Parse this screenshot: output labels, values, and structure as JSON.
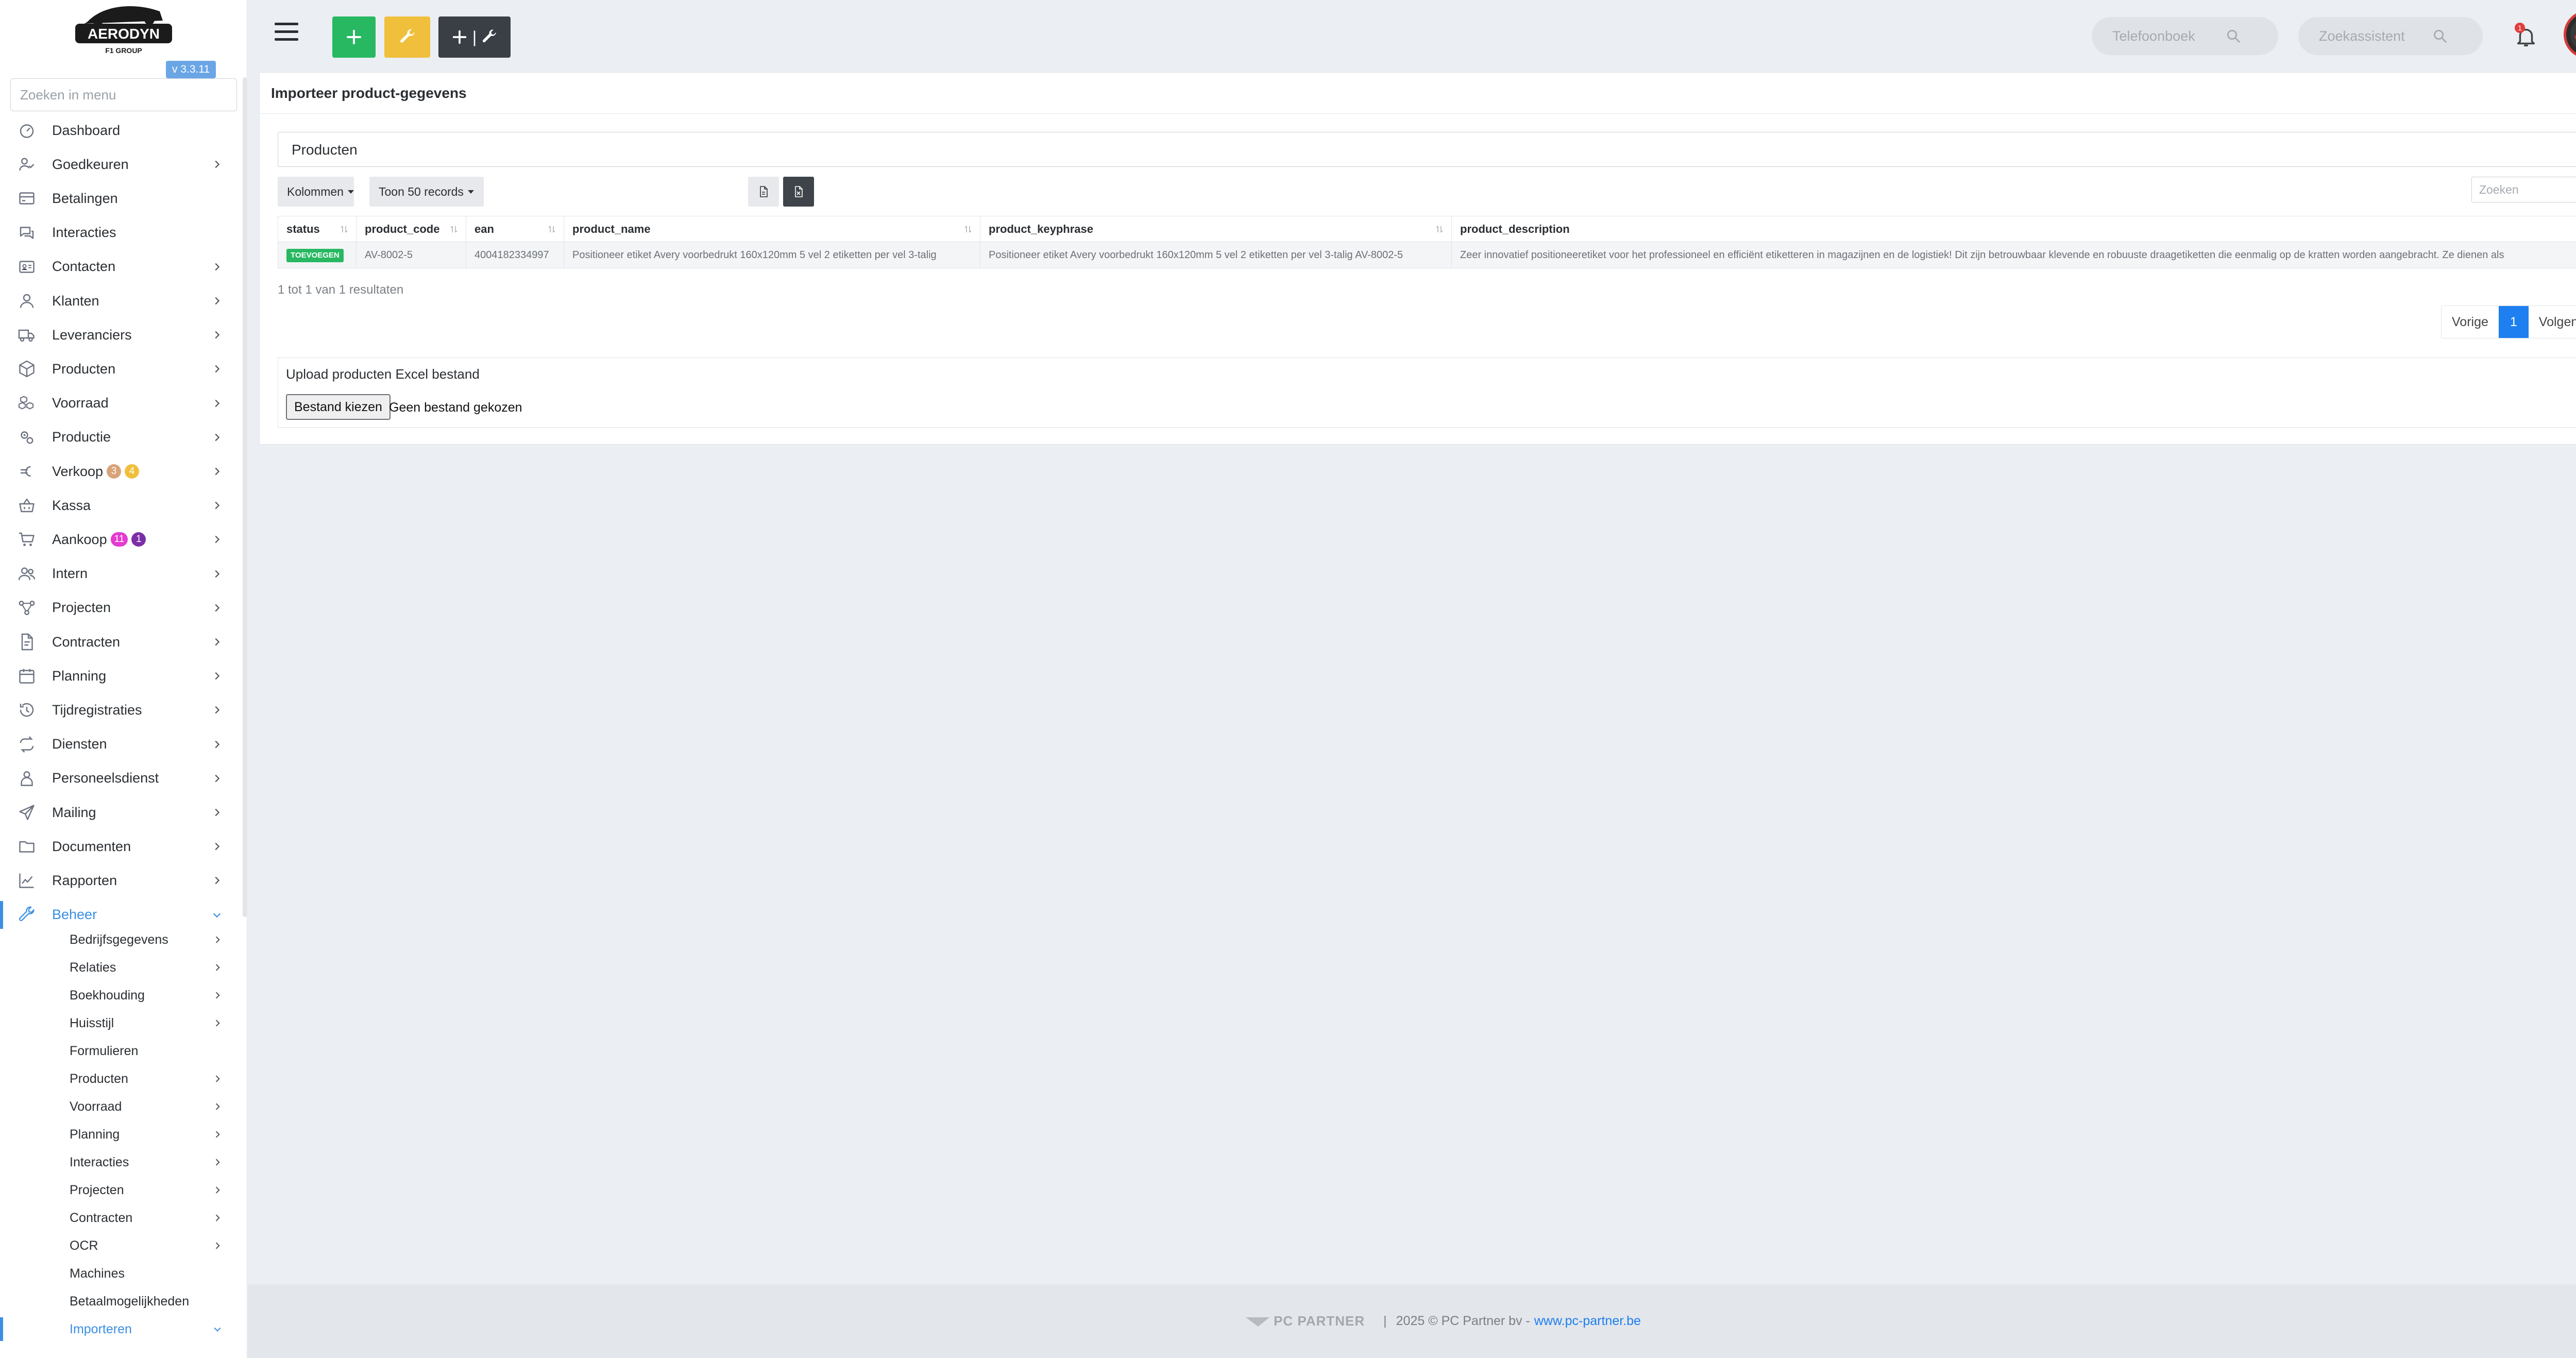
{
  "app": {
    "version": "v 3.3.11",
    "menu_search_placeholder": "Zoeken in menu"
  },
  "sidebar": {
    "items": [
      {
        "label": "Dashboard",
        "icon": "gauge-icon",
        "chevron": false
      },
      {
        "label": "Goedkeuren",
        "icon": "user-check-icon",
        "chevron": true
      },
      {
        "label": "Betalingen",
        "icon": "credit-card-icon",
        "chevron": false
      },
      {
        "label": "Interacties",
        "icon": "chat-icon",
        "chevron": false
      },
      {
        "label": "Contacten",
        "icon": "contact-card-icon",
        "chevron": true
      },
      {
        "label": "Klanten",
        "icon": "user-icon",
        "chevron": true
      },
      {
        "label": "Leveranciers",
        "icon": "truck-icon",
        "chevron": true
      },
      {
        "label": "Producten",
        "icon": "box-icon",
        "chevron": true
      },
      {
        "label": "Voorraad",
        "icon": "boxes-icon",
        "chevron": true
      },
      {
        "label": "Productie",
        "icon": "gears-icon",
        "chevron": true
      },
      {
        "label": "Verkoop",
        "icon": "euro-icon",
        "chevron": true,
        "badges": [
          {
            "text": "3",
            "color": "#d9a37a"
          },
          {
            "text": "4",
            "color": "#f0bf3c"
          }
        ]
      },
      {
        "label": "Kassa",
        "icon": "basket-icon",
        "chevron": true
      },
      {
        "label": "Aankoop",
        "icon": "cart-icon",
        "chevron": true,
        "badges": [
          {
            "text": "11",
            "color": "#e43bd0"
          },
          {
            "text": "1",
            "color": "#7b2ea6"
          }
        ]
      },
      {
        "label": "Intern",
        "icon": "users-icon",
        "chevron": true
      },
      {
        "label": "Projecten",
        "icon": "project-icon",
        "chevron": true
      },
      {
        "label": "Contracten",
        "icon": "contract-icon",
        "chevron": true
      },
      {
        "label": "Planning",
        "icon": "calendar-icon",
        "chevron": true
      },
      {
        "label": "Tijdregistraties",
        "icon": "history-icon",
        "chevron": true
      },
      {
        "label": "Diensten",
        "icon": "repeat-icon",
        "chevron": true
      },
      {
        "label": "Personeelsdienst",
        "icon": "person-badge-icon",
        "chevron": true
      },
      {
        "label": "Mailing",
        "icon": "send-icon",
        "chevron": true
      },
      {
        "label": "Documenten",
        "icon": "folder-icon",
        "chevron": true
      },
      {
        "label": "Rapporten",
        "icon": "chart-line-icon",
        "chevron": true
      },
      {
        "label": "Beheer",
        "icon": "wrench-icon",
        "chevron": true,
        "active": true,
        "expanded": true
      }
    ],
    "subitems": [
      {
        "label": "Bedrijfsgegevens",
        "chevron": true
      },
      {
        "label": "Relaties",
        "chevron": true
      },
      {
        "label": "Boekhouding",
        "chevron": true
      },
      {
        "label": "Huisstijl",
        "chevron": true
      },
      {
        "label": "Formulieren",
        "chevron": false
      },
      {
        "label": "Producten",
        "chevron": true
      },
      {
        "label": "Voorraad",
        "chevron": true
      },
      {
        "label": "Planning",
        "chevron": true
      },
      {
        "label": "Interacties",
        "chevron": true
      },
      {
        "label": "Projecten",
        "chevron": true
      },
      {
        "label": "Contracten",
        "chevron": true
      },
      {
        "label": "OCR",
        "chevron": true
      },
      {
        "label": "Machines",
        "chevron": false
      },
      {
        "label": "Betaalmogelijkheden",
        "chevron": false
      },
      {
        "label": "Importeren",
        "chevron": true,
        "active": true,
        "expanded": true
      }
    ]
  },
  "topbar": {
    "phonebook_placeholder": "Telefoonboek",
    "assistant_placeholder": "Zoekassistent",
    "notification_count": "1"
  },
  "card": {
    "title": "Importeer product-gegevens",
    "select_value": "Producten",
    "columns_button": "Kolommen",
    "records_button": "Toon 50 records",
    "search_placeholder": "Zoeken",
    "table": {
      "columns": [
        "status",
        "product_code",
        "ean",
        "product_name",
        "product_keyphrase",
        "product_description"
      ],
      "rows": [
        {
          "status": "TOEVOEGEN",
          "product_code": "AV-8002-5",
          "ean": "4004182334997",
          "product_name": "Positioneer etiket Avery voorbedrukt 160x120mm 5 vel 2 etiketten per vel 3-talig",
          "product_keyphrase": "Positioneer etiket Avery voorbedrukt 160x120mm 5 vel 2 etiketten per vel 3-talig AV-8002-5",
          "product_description": "Zeer innovatief positioneeretiket voor het professioneel en efficiënt etiketteren in magazijnen en de logistiek! Dit zijn betrouwbaar klevende en robuuste draagetiketten die eenmalig op de kratten worden aangebracht. Ze dienen als"
        }
      ]
    },
    "info": "1 tot 1 van 1 resultaten",
    "pager": {
      "prev": "Vorige",
      "current": "1",
      "next": "Volgende"
    },
    "upload": {
      "title": "Upload producten Excel bestand",
      "button": "Bestand kiezen",
      "no_file": "Geen bestand gekozen"
    }
  },
  "footer": {
    "logo_text": "PC PARTNER",
    "divider": "|",
    "copyright": "2025 © PC Partner bv -",
    "link": "www.pc-partner.be"
  }
}
